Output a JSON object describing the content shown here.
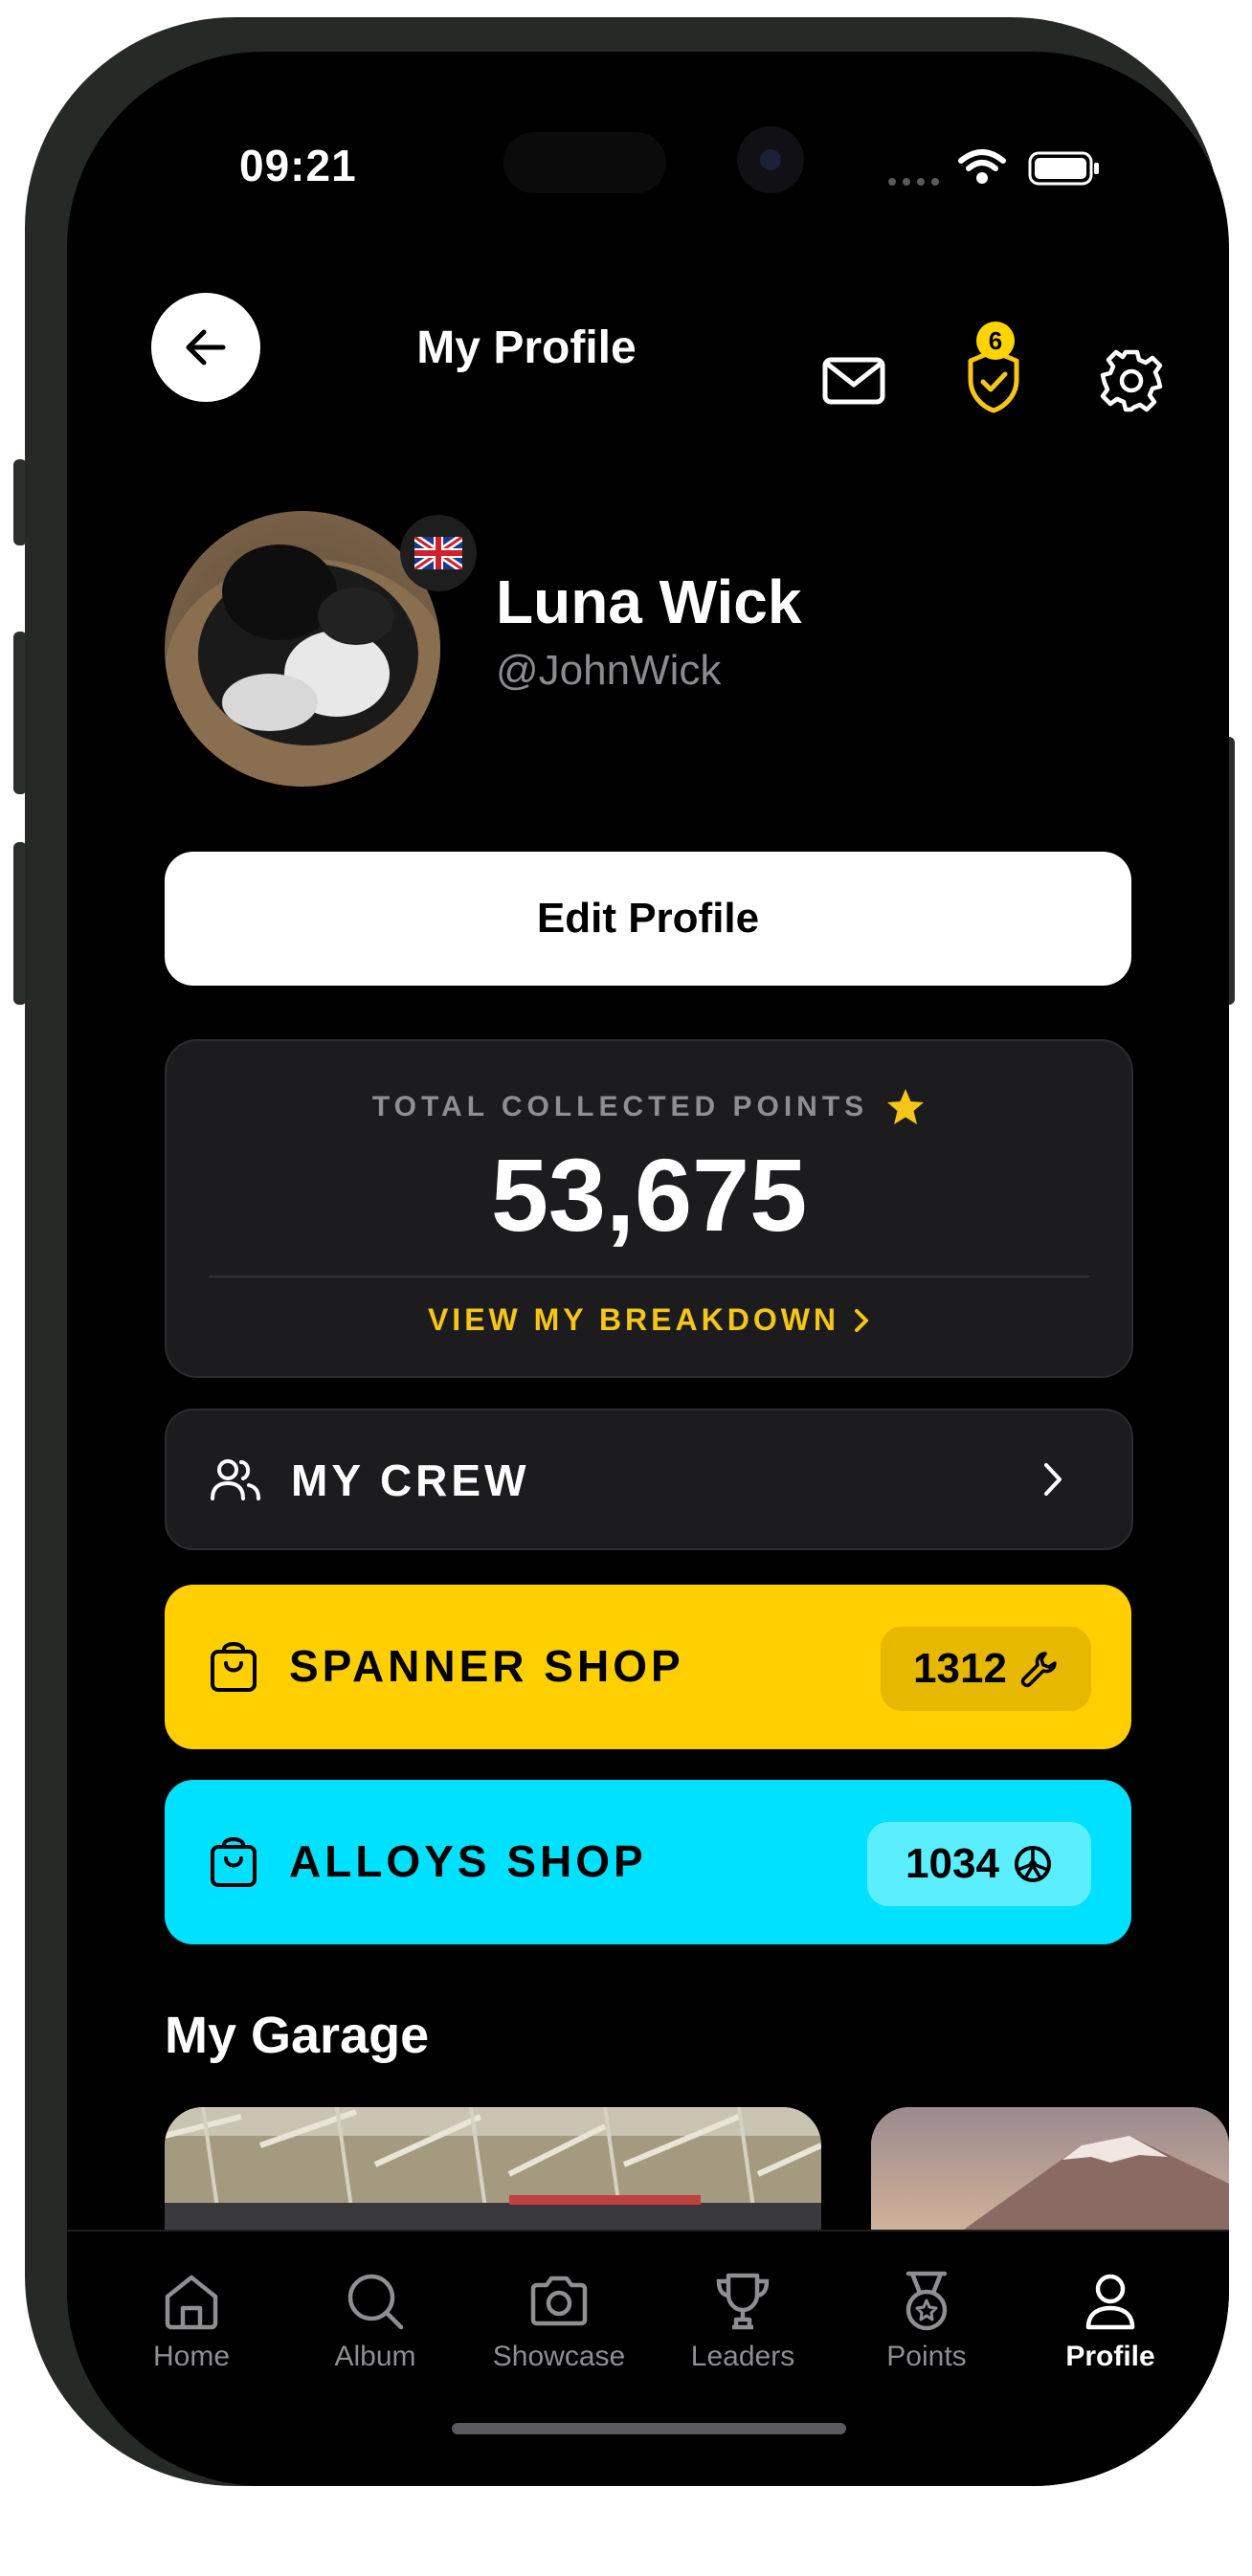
{
  "status_bar": {
    "time": "09:21"
  },
  "header": {
    "title": "My Profile",
    "notifications_badge": "6"
  },
  "profile": {
    "name": "Luna Wick",
    "handle": "@JohnWick",
    "flag": "uk-flag"
  },
  "edit_profile_label": "Edit Profile",
  "points_card": {
    "label": "TOTAL COLLECTED POINTS",
    "value": "53,675",
    "link_label": "VIEW MY BREAKDOWN"
  },
  "crew": {
    "label": "MY CREW"
  },
  "shops": [
    {
      "label": "SPANNER SHOP",
      "count": "1312",
      "color": "#ffcf00",
      "pill_color": "#e6b800",
      "icon": "wrench-icon"
    },
    {
      "label": "ALLOYS SHOP",
      "count": "1034",
      "color": "#00e1ff",
      "pill_color": "#5aeeff",
      "icon": "wheel-icon"
    }
  ],
  "garage": {
    "title": "My Garage"
  },
  "tabs": [
    {
      "label": "Home",
      "icon": "home-icon",
      "active": false
    },
    {
      "label": "Album",
      "icon": "search-icon",
      "active": false
    },
    {
      "label": "Showcase",
      "icon": "camera-icon",
      "active": false
    },
    {
      "label": "Leaders",
      "icon": "trophy-icon",
      "active": false
    },
    {
      "label": "Points",
      "icon": "medal-icon",
      "active": false
    },
    {
      "label": "Profile",
      "icon": "person-icon",
      "active": true
    }
  ],
  "colors": {
    "accent_yellow": "#f5c518",
    "background": "#000000",
    "card": "#1c1c1e"
  }
}
